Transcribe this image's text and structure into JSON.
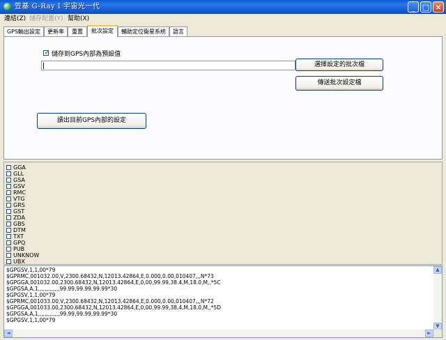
{
  "window": {
    "title": "笠基 G-Ray I 宇宙光一代"
  },
  "menu": [
    {
      "label": "連結(Z)",
      "disabled": false
    },
    {
      "label": "儲存配置(Y)",
      "disabled": true
    },
    {
      "label": "幫助(X)",
      "disabled": false
    }
  ],
  "tabs": [
    {
      "label": "GPS輸出設定",
      "active": false
    },
    {
      "label": "更新率",
      "active": false
    },
    {
      "label": "重置",
      "active": false
    },
    {
      "label": "批次設定",
      "active": true
    },
    {
      "label": "輔助定位衛星系統",
      "active": false
    },
    {
      "label": "語言",
      "active": false
    }
  ],
  "batch": {
    "save_default_label": "儲存到GPS內部為預設值",
    "save_default_checked": true,
    "file_path": "",
    "select_file_button": "選擇設定的批次檔",
    "send_batch_button": "傳送批次設定檔",
    "read_settings_button": "讀出目前GPS內部的設定"
  },
  "nmea_sentences": [
    "GGA",
    "GLL",
    "GSA",
    "GSV",
    "RMC",
    "VTG",
    "GRS",
    "GST",
    "ZDA",
    "GBS",
    "DTM",
    "TXT",
    "GPQ",
    "PUB",
    "UNKNOW",
    "UBX"
  ],
  "log_lines": [
    "$GPGSV,1,1,00*79",
    "$GPRMC,001032.00,V,2300.68432,N,12013.42864,E,0.000,0.00,010407,,,N*73",
    "$GPGGA,001032.00,2300.68432,N,12013.42864,E,0,00,99.99,38.4,M,18.0,M,,*5C",
    "$GPGSA,A,1,,,,,,,,,,,,,99.99,99.99,99.99*30",
    "$GPGSV,1,1,00*79",
    "$GPRMC,001033.00,V,2300.68432,N,12013.42864,E,0.000,0.00,010407,,,N*72",
    "$GPGGA,001033.00,2300.68432,N,12013.42864,E,0,00,99.99,38.4,M,18.0,M,,*5D",
    "$GPGSA,A,1,,,,,,,,,,,,,99.99,99.99,99.99*30",
    "$GPGSV,1,1,00*79"
  ],
  "caption_buttons": {
    "minimize": "_",
    "maximize": "□",
    "close": "×"
  },
  "scroll_arrows": {
    "up": "▲",
    "down": "▼",
    "left": "◄",
    "right": "►"
  },
  "icons": {
    "app": "globe-icon",
    "check": "checkmark-icon"
  },
  "colors": {
    "titlebar": "#0a5bd6",
    "active_tab_accent": "#ffc83c",
    "check": "#21a121"
  }
}
